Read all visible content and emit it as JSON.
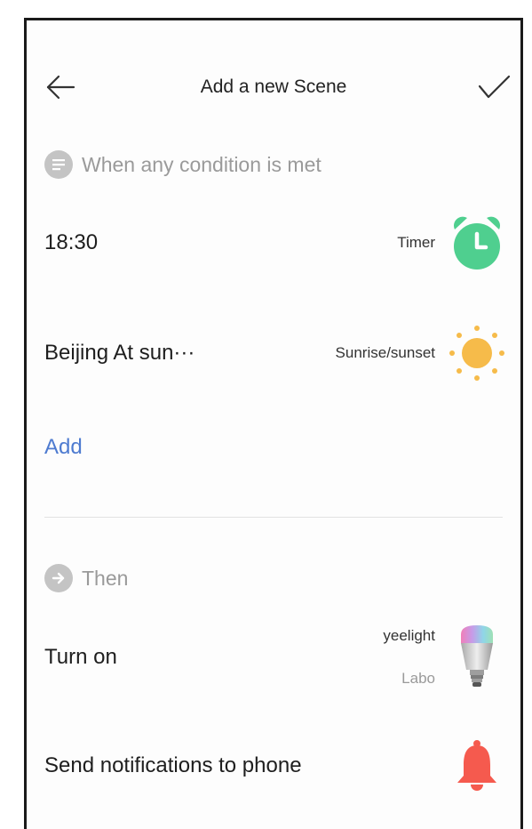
{
  "header": {
    "title": "Add a new Scene",
    "back_icon": "arrow-left-icon",
    "confirm_icon": "checkmark-icon"
  },
  "conditions": {
    "label": "When any condition is met",
    "icon": "condition-list-icon",
    "items": [
      {
        "value": "18:30",
        "type": "Timer",
        "icon": "alarm-clock-icon",
        "color": "#4fcf8f"
      },
      {
        "value": "Beijing At sun···",
        "type": "Sunrise/sunset",
        "icon": "sun-icon",
        "color": "#f6bb4a"
      }
    ],
    "add_label": "Add"
  },
  "actions": {
    "label": "Then",
    "icon": "arrow-right-circle-icon",
    "items": [
      {
        "value": "Turn on",
        "device_name": "yeelight",
        "device_room": "Labo",
        "icon": "bulb-icon"
      },
      {
        "value": "Send notifications to phone",
        "icon": "bell-icon",
        "color": "#f55a4e"
      }
    ]
  },
  "colors": {
    "link": "#4e7bd0",
    "muted": "#9a9a9a"
  }
}
